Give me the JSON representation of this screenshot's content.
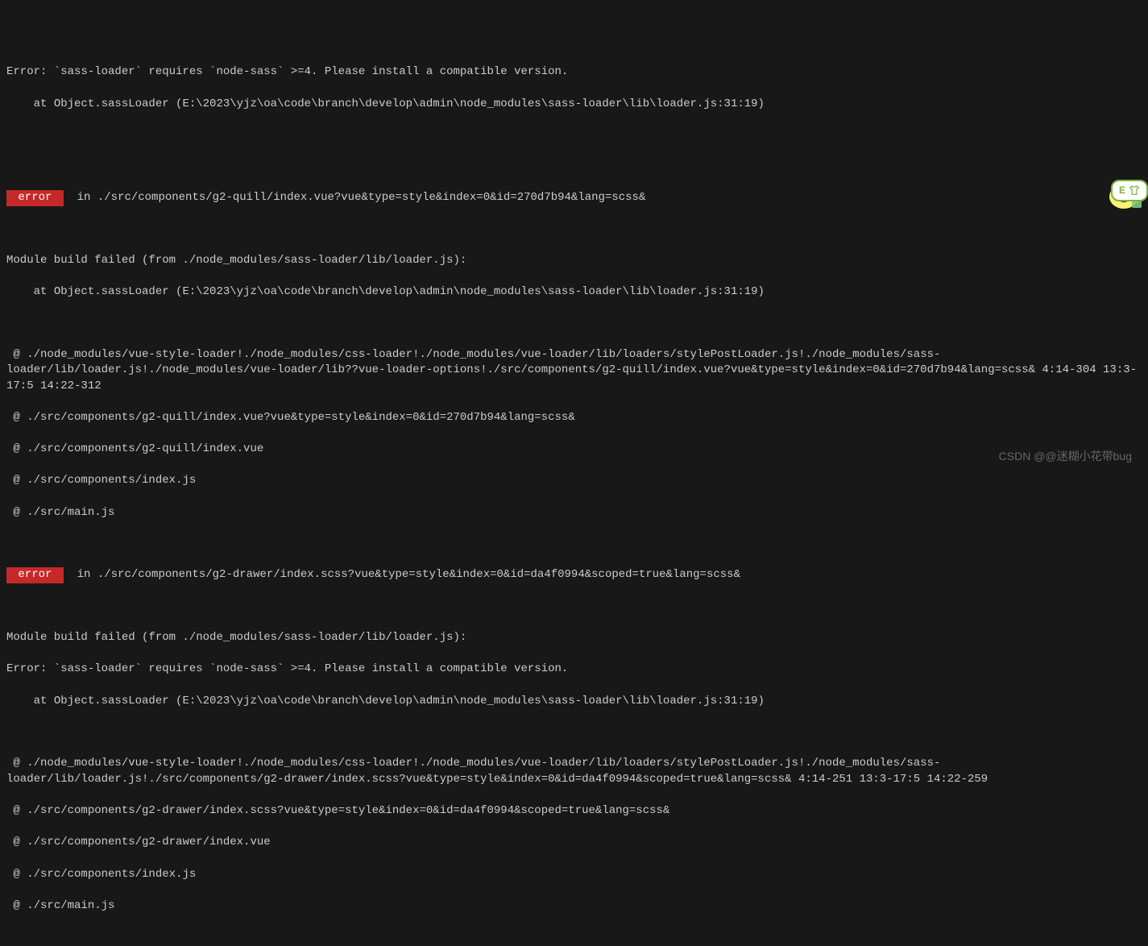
{
  "block1": {
    "error_line": "Error: `sass-loader` requires `node-sass` >=4. Please install a compatible version.",
    "stack_line": "    at Object.sassLoader (E:\\2023\\yjz\\oa\\code\\branch\\develop\\admin\\node_modules\\sass-loader\\lib\\loader.js:31:19)"
  },
  "error1": {
    "badge": " error ",
    "in_text": "  in ./src/components/g2-quill/index.vue?vue&type=style&index=0&id=270d7b94&lang=scss&"
  },
  "block2": {
    "l1": "Module build failed (from ./node_modules/sass-loader/lib/loader.js):",
    "l2": "    at Object.sassLoader (E:\\2023\\yjz\\oa\\code\\branch\\develop\\admin\\node_modules\\sass-loader\\lib\\loader.js:31:19)"
  },
  "trace1": {
    "l1": " @ ./node_modules/vue-style-loader!./node_modules/css-loader!./node_modules/vue-loader/lib/loaders/stylePostLoader.js!./node_modules/sass-loader/lib/loader.js!./node_modules/vue-loader/lib??vue-loader-options!./src/components/g2-quill/index.vue?vue&type=style&index=0&id=270d7b94&lang=scss& 4:14-304 13:3-17:5 14:22-312",
    "l2": " @ ./src/components/g2-quill/index.vue?vue&type=style&index=0&id=270d7b94&lang=scss&",
    "l3": " @ ./src/components/g2-quill/index.vue",
    "l4": " @ ./src/components/index.js",
    "l5": " @ ./src/main.js"
  },
  "error2": {
    "badge": " error ",
    "in_text": "  in ./src/components/g2-drawer/index.scss?vue&type=style&index=0&id=da4f0994&scoped=true&lang=scss&"
  },
  "block3": {
    "l1": "Module build failed (from ./node_modules/sass-loader/lib/loader.js):",
    "l2": "Error: `sass-loader` requires `node-sass` >=4. Please install a compatible version.",
    "l3": "    at Object.sassLoader (E:\\2023\\yjz\\oa\\code\\branch\\develop\\admin\\node_modules\\sass-loader\\lib\\loader.js:31:19)"
  },
  "trace2": {
    "l1": " @ ./node_modules/vue-style-loader!./node_modules/css-loader!./node_modules/vue-loader/lib/loaders/stylePostLoader.js!./node_modules/sass-loader/lib/loader.js!./src/components/g2-drawer/index.scss?vue&type=style&index=0&id=da4f0994&scoped=true&lang=scss& 4:14-251 13:3-17:5 14:22-259",
    "l2": " @ ./src/components/g2-drawer/index.scss?vue&type=style&index=0&id=da4f0994&scoped=true&lang=scss&",
    "l3": " @ ./src/components/g2-drawer/index.vue",
    "l4": " @ ./src/components/index.js",
    "l5": " @ ./src/main.js"
  },
  "watermark": "CSDN @@迷糊小花带bug",
  "widget": {
    "letter": "E"
  }
}
